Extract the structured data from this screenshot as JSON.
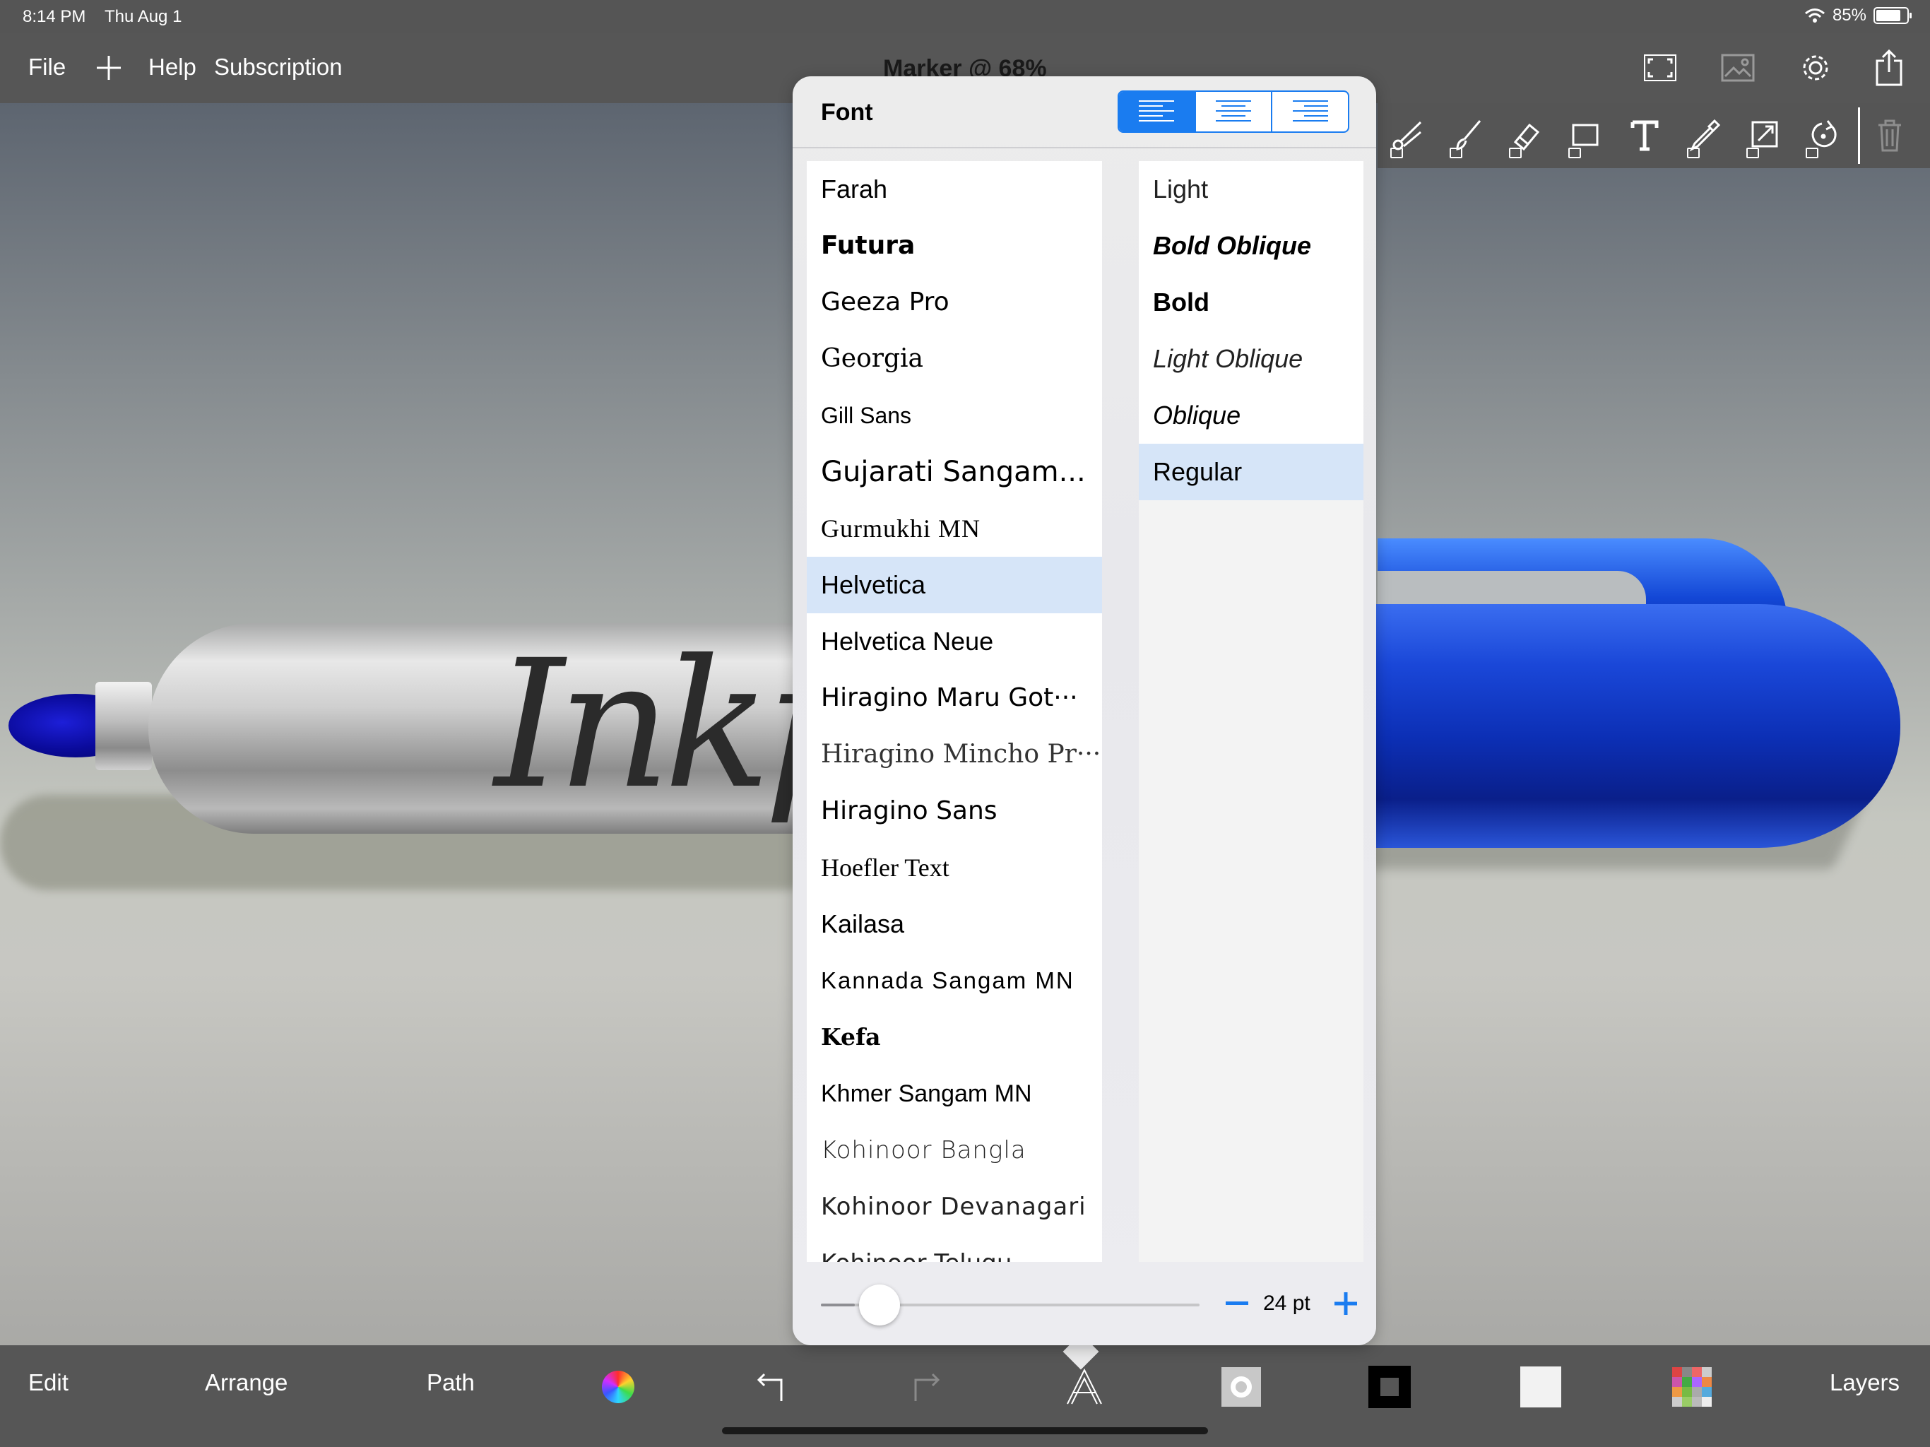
{
  "status": {
    "time": "8:14 PM",
    "date": "Thu Aug 1",
    "battery": "85%"
  },
  "topbar": {
    "menu": [
      "File",
      "Help",
      "Subscription"
    ],
    "title": "Marker @ 68%"
  },
  "artwork": {
    "marker_text": "Inkp"
  },
  "popover": {
    "title": "Font",
    "fonts": [
      "Farah",
      "Futura",
      "Geeza Pro",
      "Georgia",
      "Gill Sans",
      "Gujarati Sangam...",
      "Gurmukhi MN",
      "Helvetica",
      "Helvetica Neue",
      "Hiragino Maru Got···",
      "Hiragino Mincho Pr···",
      "Hiragino Sans",
      "Hoefler Text",
      "Kailasa",
      "Kannada Sangam MN",
      "Kefa",
      "Khmer Sangam MN",
      "Kohinoor Bangla",
      "Kohinoor Devanagari",
      "Kohinoor Telugu"
    ],
    "selected_font": "Helvetica",
    "styles": [
      "Light",
      "Bold Oblique",
      "Bold",
      "Light Oblique",
      "Oblique",
      "Regular"
    ],
    "selected_style": "Regular",
    "size_label": "24 pt",
    "size_slider_fraction": 0.09,
    "alignment_selected": "left"
  },
  "bottombar": {
    "edit": "Edit",
    "arrange": "Arrange",
    "path": "Path",
    "layers": "Layers"
  },
  "colors": {
    "accent": "#1a7cf0",
    "selection": "#d6e5f8",
    "bar": "#565656"
  }
}
